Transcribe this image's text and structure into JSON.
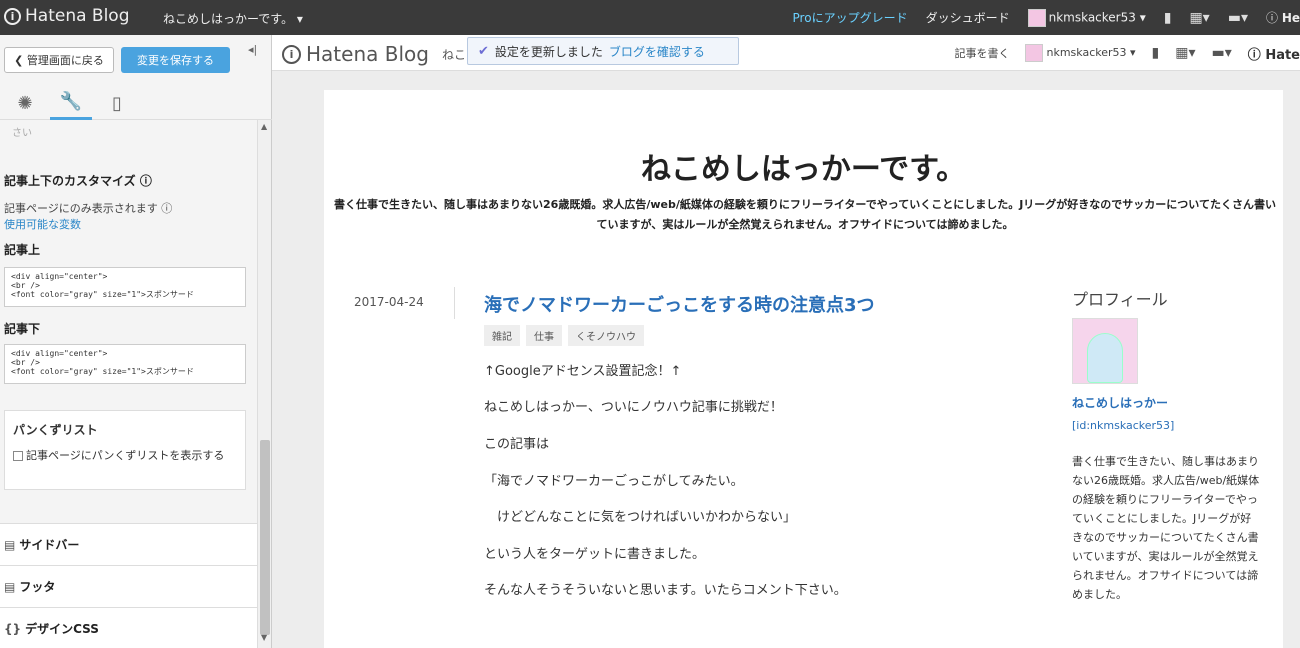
{
  "topbar": {
    "logo": "Hatena Blog",
    "blog_selector": "ねこめしはっかーです。 ▾",
    "upgrade": "Proにアップグレード",
    "dashboard": "ダッシュボード",
    "user": "nkmskacker53 ▾",
    "hatena": "He"
  },
  "left": {
    "back": "❮ 管理画面に戻る",
    "save": "変更を保存する",
    "collapse": "◂|",
    "faded_text": "さい",
    "section_title": "記事上下のカスタマイズ ⓘ",
    "section_desc": "記事ページにのみ表示されます ⓘ",
    "section_link": "使用可能な変数",
    "above_label": "記事上",
    "above_code": "<div align=\"center\">\n<br />\n<font color=\"gray\" size=\"1\">スポンサード",
    "below_label": "記事下",
    "below_code": "<div align=\"center\">\n<br />\n<font color=\"gray\" size=\"1\">スポンサード",
    "breadcrumb_title": "パンくずリスト",
    "breadcrumb_check": "記事ページにパンくずリストを表示する",
    "acc_sidebar": "サイドバー",
    "acc_footer": "フッタ",
    "acc_css": "デザインCSS",
    "acc_css_icon": "{}"
  },
  "preview": {
    "logo": "Hatena Blog",
    "blog": "ねこ",
    "notice_text": "設定を更新しました",
    "notice_link": "ブログを確認する",
    "write": "記事を書く",
    "user": "nkmskacker53 ▾",
    "hatena": "Hate",
    "blog_title": "ねこめしはっかーです。",
    "blog_desc": "書く仕事で生きたい、随し事はあまりない26歳既婚。求人広告/web/紙媒体の経験を頼りにフリーライターでやっていくことにしました。Jリーグが好きなのでサッカーについてたくさん書いていますが、実はルールが全然覚えられません。オフサイドについては諦めました。",
    "date": "2017-04-24",
    "entry_title": "海でノマドワーカーごっこをする時の注意点3つ",
    "categories": [
      "雑記",
      "仕事",
      "くそノウハウ"
    ],
    "paras": [
      "↑Googleアドセンス設置記念！↑",
      "ねこめしはっかー、ついにノウハウ記事に挑戦だ！",
      "この記事は",
      "「海でノマドワーカーごっこがしてみたい。",
      "　けどどんなことに気をつければいいかわからない」",
      "という人をターゲットに書きました。",
      "そんな人そうそういないと思います。いたらコメント下さい。"
    ],
    "side_heading": "プロフィール",
    "side_name": "ねこめしはっかー",
    "side_id": "[id:nkmskacker53]",
    "side_desc": "書く仕事で生きたい、随し事はあまりない26歳既婚。求人広告/web/紙媒体の経験を頼りにフリーライターでやっていくことにしました。Jリーグが好きなのでサッカーについてたくさん書いていますが、実はルールが全然覚えられません。オフサイドについては諦めました。"
  },
  "colors": {
    "accent": "#4aa3df",
    "link": "#2a6fb8",
    "topbar": "#3a3a3a"
  }
}
